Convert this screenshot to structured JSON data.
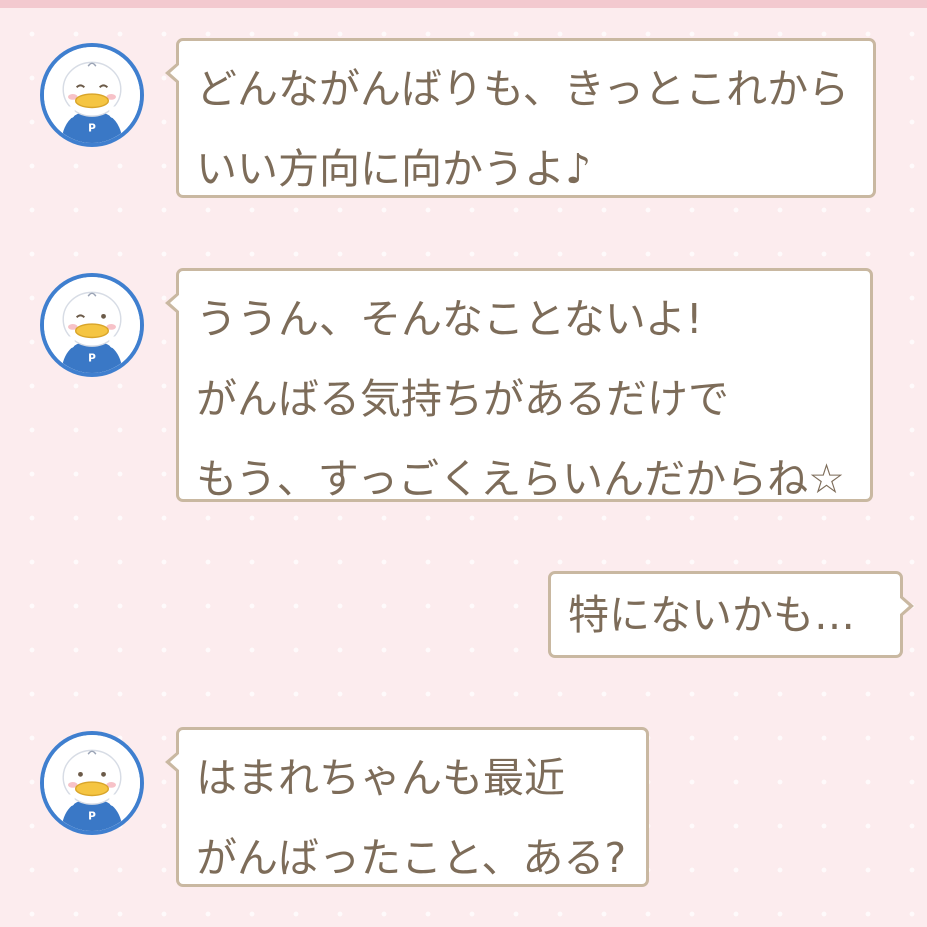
{
  "chat": {
    "messages": [
      {
        "sender": "pekkle",
        "side": "left",
        "lines": [
          "どんながんばりも、きっとこれから",
          "いい方向に向かうよ♪"
        ]
      },
      {
        "sender": "pekkle",
        "side": "left",
        "lines": [
          "ううん、そんなことないよ!",
          "がんばる気持ちがあるだけで",
          "もう、すっごくえらいんだからね☆"
        ]
      },
      {
        "sender": "user",
        "side": "right",
        "lines": [
          "特にないかも…"
        ]
      },
      {
        "sender": "pekkle",
        "side": "left",
        "lines": [
          "はまれちゃんも最近",
          "がんばったこと、ある?"
        ]
      }
    ]
  },
  "avatar": {
    "icon": "duck-character-icon",
    "badge_letter": "P"
  },
  "colors": {
    "background": "#fcecee",
    "bubble_border": "#c9b8a1",
    "text": "#7d6c59",
    "avatar_ring": "#3f7fcf",
    "beak": "#f5c542",
    "shirt": "#3a78c6"
  }
}
